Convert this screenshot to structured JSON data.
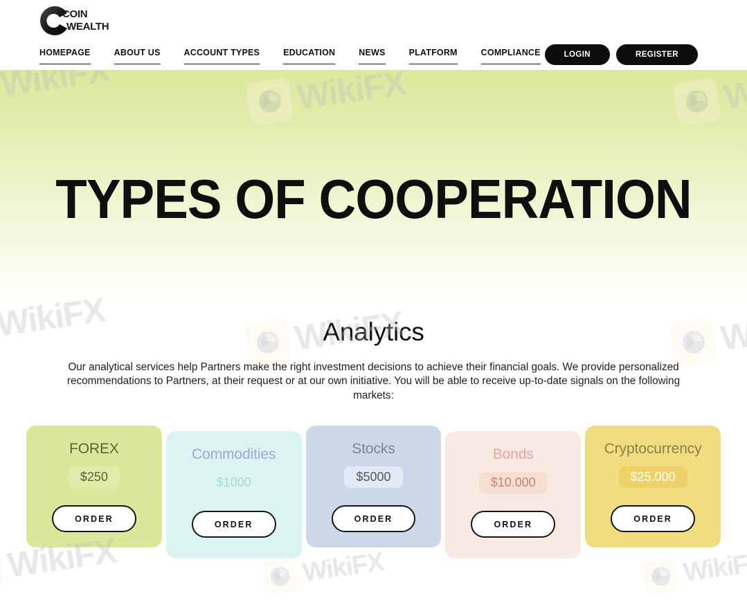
{
  "brand": {
    "logo_line1": "COIN",
    "logo_line2": "WEALTH",
    "logo_icon": "letter-c-logo-icon"
  },
  "nav": {
    "items": [
      {
        "label": "HOMEPAGE"
      },
      {
        "label": "ABOUT US"
      },
      {
        "label": "ACCOUNT TYPES"
      },
      {
        "label": "EDUCATION"
      },
      {
        "label": "NEWS"
      },
      {
        "label": "PLATFORM"
      },
      {
        "label": "COMPLIANCE"
      }
    ],
    "login_label": "LOGIN",
    "register_label": "REGISTER"
  },
  "hero": {
    "title": "TYPES OF COOPERATION",
    "gradient_top": "#dde79b",
    "gradient_bottom": "#ffffff"
  },
  "analytics": {
    "title": "Analytics",
    "description": "Our analytical services help Partners make the right investment decisions to achieve their financial goals. We provide personalized recommendations to Partners, at their request or at our own initiative. You will be able to receive up-to-date signals on the following markets:"
  },
  "cards": [
    {
      "title": "FOREX",
      "price": "$250",
      "order_label": "ORDER",
      "bg": "#dde79b",
      "title_color": "#5d6135",
      "price_color": "#5d6135",
      "price_bg": "#e3ebab"
    },
    {
      "title": "Commodities",
      "price": "$1000",
      "order_label": "ORDER",
      "bg": "#d9f4f1",
      "title_color": "#93aed0",
      "price_color": "#aad5d1",
      "price_bg": "#ddf5f2"
    },
    {
      "title": "Stocks",
      "price": "$5000",
      "order_label": "ORDER",
      "bg": "#ccd8e8",
      "title_color": "#7c8694",
      "price_color": "#4f5763",
      "price_bg": "#e2eaf4"
    },
    {
      "title": "Bonds",
      "price": "$10.000",
      "order_label": "ORDER",
      "bg": "#f9e9e3",
      "title_color": "#e8a3a3",
      "price_color": "#c08676",
      "price_bg": "#f6ded3"
    },
    {
      "title": "Cryptocurrency",
      "price": "$25.000",
      "order_label": "ORDER",
      "bg": "#f2dc80",
      "title_color": "#8c8049",
      "price_color": "#ffffff",
      "price_bg": "#eed268"
    }
  ],
  "watermarks": [
    {
      "text": "WikiFX"
    },
    {
      "text": "WikiFX"
    },
    {
      "text": "WikiFX"
    },
    {
      "text": "WikiFX"
    },
    {
      "text": "WikiFX"
    },
    {
      "text": "WikiFX"
    },
    {
      "text": "WikiFX"
    }
  ]
}
